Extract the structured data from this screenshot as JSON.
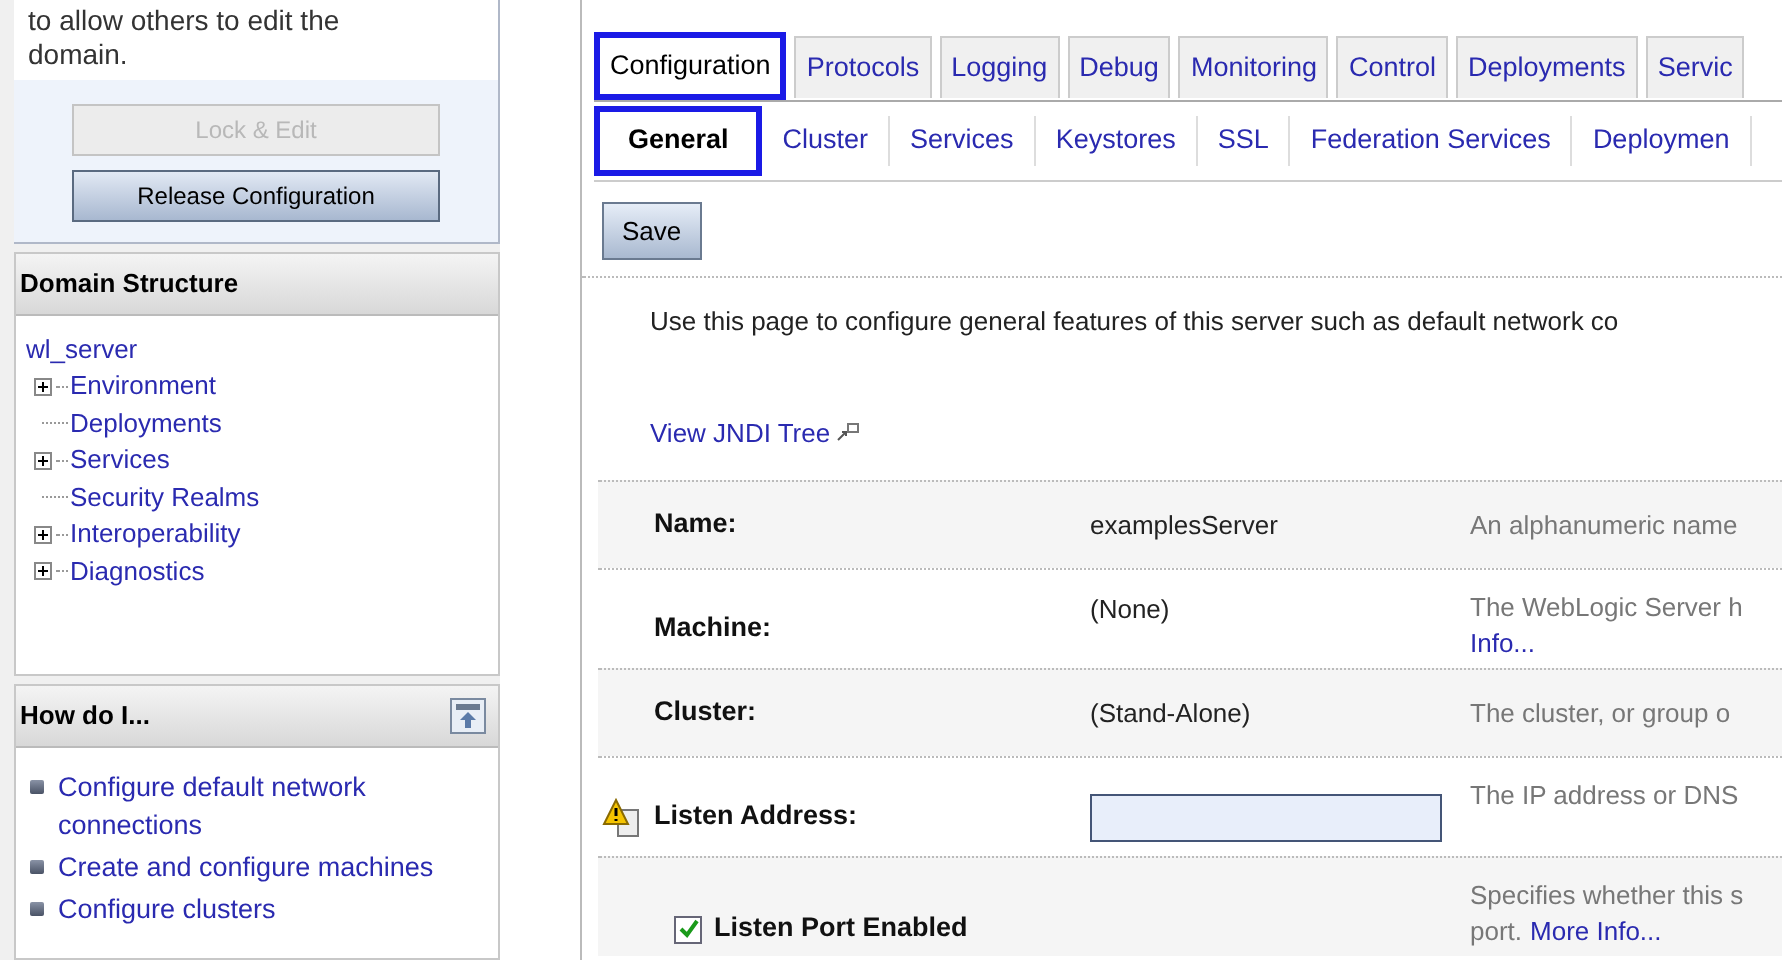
{
  "change_center": {
    "text": "to allow others to edit the domain.",
    "buttons": [
      {
        "label": "Lock & Edit",
        "disabled": true
      },
      {
        "label": "Release Configuration",
        "disabled": false
      }
    ]
  },
  "domain_structure": {
    "title": "Domain Structure",
    "root": "wl_server",
    "children": [
      {
        "label": "Environment",
        "kind": "node"
      },
      {
        "label": "Deployments",
        "kind": "leaf"
      },
      {
        "label": "Services",
        "kind": "node"
      },
      {
        "label": "Security Realms",
        "kind": "leaf"
      },
      {
        "label": "Interoperability",
        "kind": "node"
      },
      {
        "label": "Diagnostics",
        "kind": "node"
      }
    ]
  },
  "how_do_i": {
    "title": "How do I...",
    "items": [
      "Configure default network connections",
      "Create and configure machines",
      "Configure clusters"
    ]
  },
  "tabs": [
    {
      "label": "Configuration",
      "selected": true
    },
    {
      "label": "Protocols",
      "selected": false
    },
    {
      "label": "Logging",
      "selected": false
    },
    {
      "label": "Debug",
      "selected": false
    },
    {
      "label": "Monitoring",
      "selected": false
    },
    {
      "label": "Control",
      "selected": false
    },
    {
      "label": "Deployments",
      "selected": false
    },
    {
      "label": "Servic",
      "selected": false
    }
  ],
  "subtabs": [
    {
      "label": "General",
      "selected": true
    },
    {
      "label": "Cluster",
      "selected": false
    },
    {
      "label": "Services",
      "selected": false
    },
    {
      "label": "Keystores",
      "selected": false
    },
    {
      "label": "SSL",
      "selected": false
    },
    {
      "label": "Federation Services",
      "selected": false
    },
    {
      "label": "Deploymen",
      "selected": false
    }
  ],
  "save_button": "Save",
  "description": "Use this page to configure general features of this server such as default network co",
  "jndi_link": "View JNDI Tree",
  "rows": [
    {
      "kind": "text",
      "label": "Name:",
      "value": "examplesServer",
      "help": "An alphanumeric name"
    },
    {
      "kind": "text",
      "label": "Machine:",
      "value": "(None)",
      "help": "The WebLogic Server h",
      "link": "Info..."
    },
    {
      "kind": "text",
      "label": "Cluster:",
      "value": "(Stand-Alone)",
      "help": "The cluster, or group o"
    },
    {
      "kind": "field",
      "label": "Listen Address:",
      "warning": true,
      "help": "The IP address or DNS"
    },
    {
      "kind": "checkbox",
      "label": "Listen Port Enabled",
      "checked": true,
      "help": "Specifies whether this s",
      "help2": "port.",
      "link": "More Info..."
    }
  ]
}
